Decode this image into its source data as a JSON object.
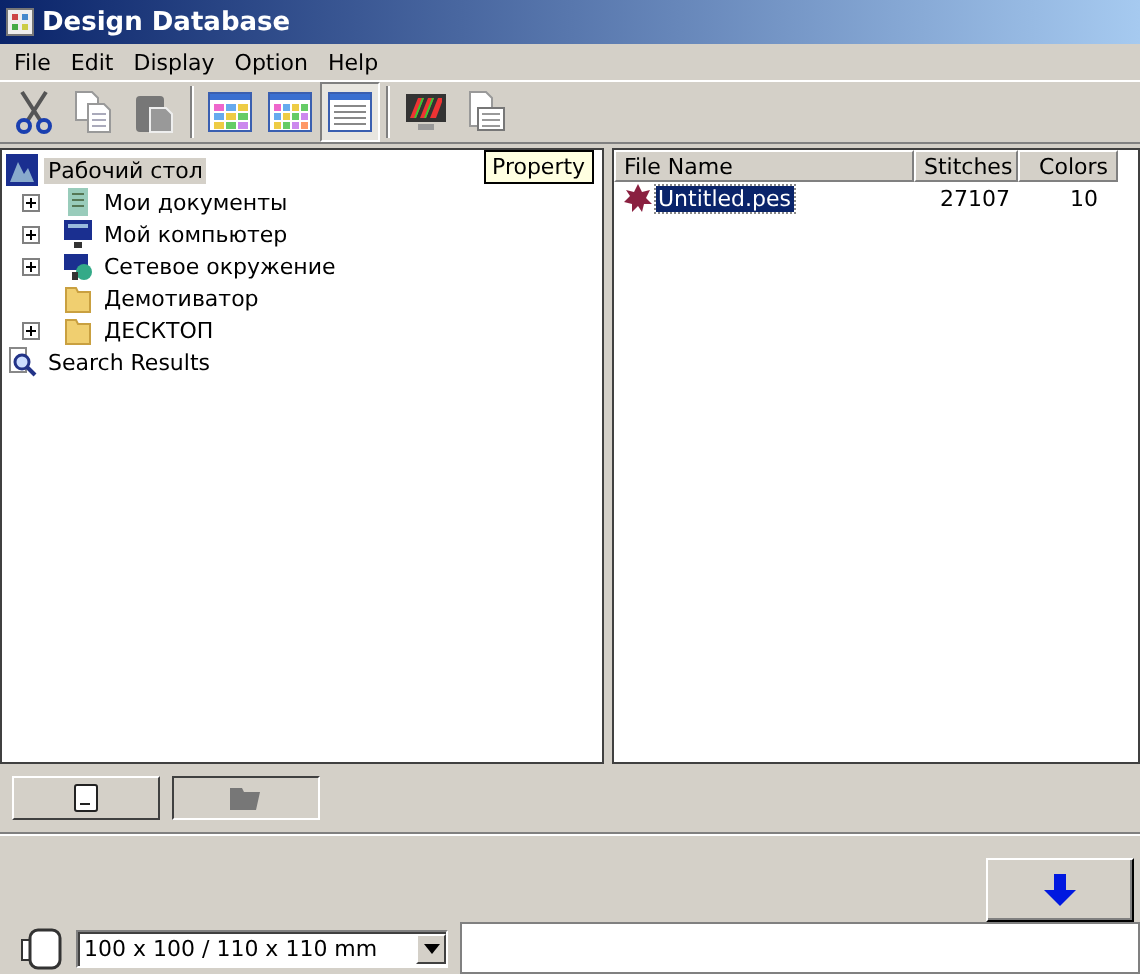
{
  "window": {
    "title": "Design Database"
  },
  "menu": [
    "File",
    "Edit",
    "Display",
    "Option",
    "Help"
  ],
  "toolbar": [
    {
      "kind": "cut",
      "selected": false
    },
    {
      "kind": "copy",
      "selected": false
    },
    {
      "kind": "paste",
      "selected": false
    },
    {
      "kind": "sep"
    },
    {
      "kind": "large",
      "selected": false
    },
    {
      "kind": "small",
      "selected": false
    },
    {
      "kind": "list",
      "selected": true
    },
    {
      "kind": "sep"
    },
    {
      "kind": "colors",
      "selected": false
    },
    {
      "kind": "property",
      "selected": false,
      "tooltip": "Property"
    }
  ],
  "tree": {
    "label": "Рабочий стол",
    "selected": true,
    "children": [
      {
        "label": "Мои документы",
        "kind": "docs",
        "expandable": true
      },
      {
        "label": "Мой компьютер",
        "kind": "computer",
        "expandable": true
      },
      {
        "label": "Сетевое окружение",
        "kind": "network",
        "expandable": true
      },
      {
        "label": "Демотиватор",
        "kind": "folder",
        "expandable": false
      },
      {
        "label": "ДЕСКТОП",
        "kind": "folder",
        "expandable": true
      }
    ]
  },
  "search_results": "Search Results",
  "table": {
    "columns": [
      "File Name",
      "Stitches",
      "Colors"
    ],
    "rows": [
      {
        "cells": [
          "Untitled.pes",
          "27107",
          "10"
        ],
        "selected": true
      }
    ]
  },
  "view_buttons": [
    {
      "kind": "page",
      "selected": false
    },
    {
      "kind": "folder",
      "selected": true
    }
  ],
  "hoop": {
    "value": "100 x 100 / 110 x 110 mm"
  }
}
